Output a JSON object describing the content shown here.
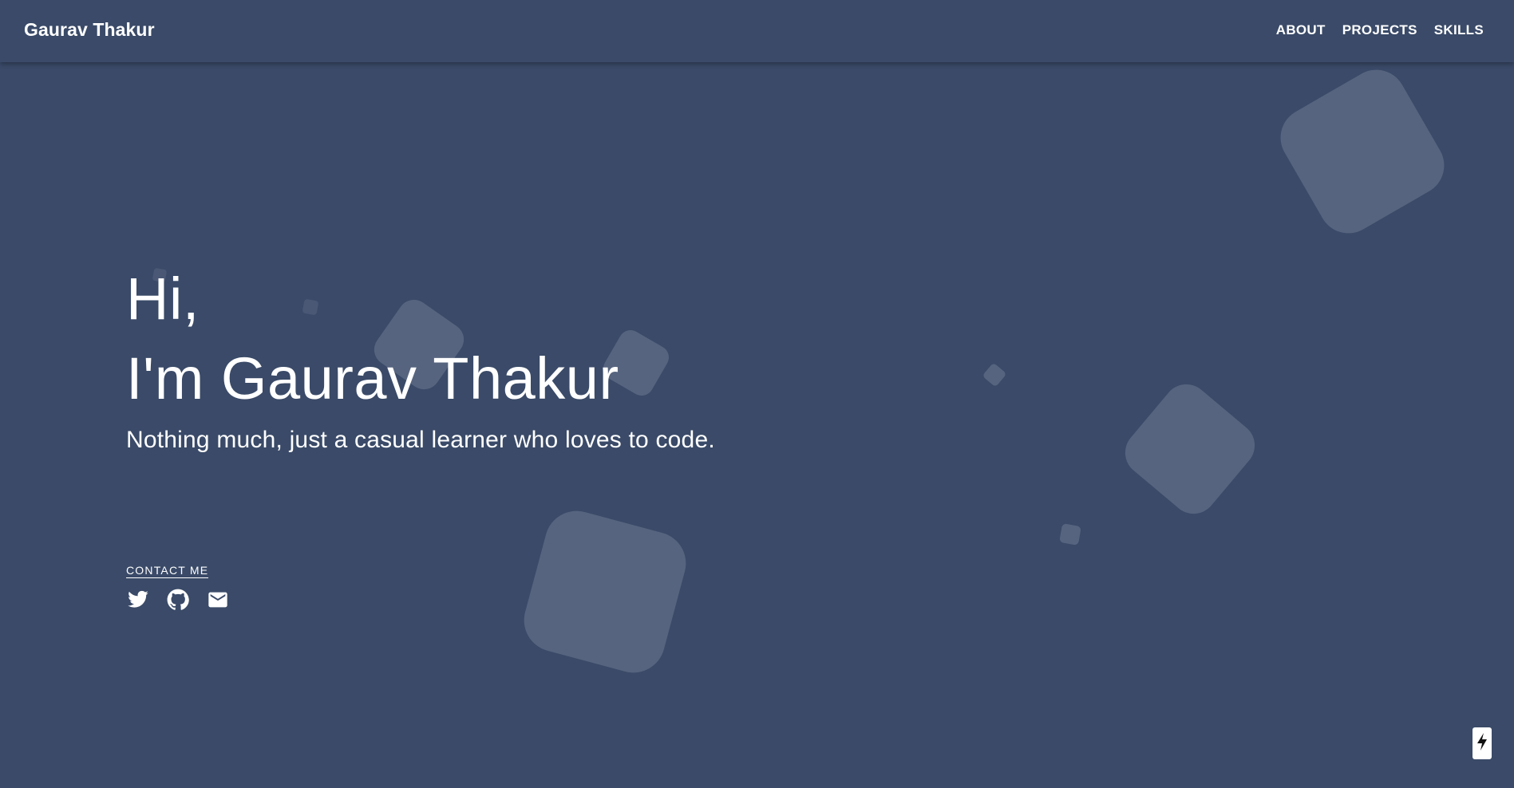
{
  "navbar": {
    "brand": "Gaurav Thakur",
    "links": [
      {
        "label": "ABOUT"
      },
      {
        "label": "PROJECTS"
      },
      {
        "label": "SKILLS"
      }
    ]
  },
  "hero": {
    "greeting": "Hi,",
    "name_line": "I'm Gaurav Thakur",
    "tagline": "Nothing much, just a casual learner who loves to code."
  },
  "contact": {
    "label": "CONTACT ME",
    "socials": [
      {
        "icon": "twitter-icon"
      },
      {
        "icon": "github-icon"
      },
      {
        "icon": "mail-icon"
      }
    ]
  },
  "floating_button": {
    "icon": "lightning-bolt-icon"
  },
  "colors": {
    "background": "#3a4a68",
    "shape": "#56647f",
    "text": "#ffffff"
  }
}
